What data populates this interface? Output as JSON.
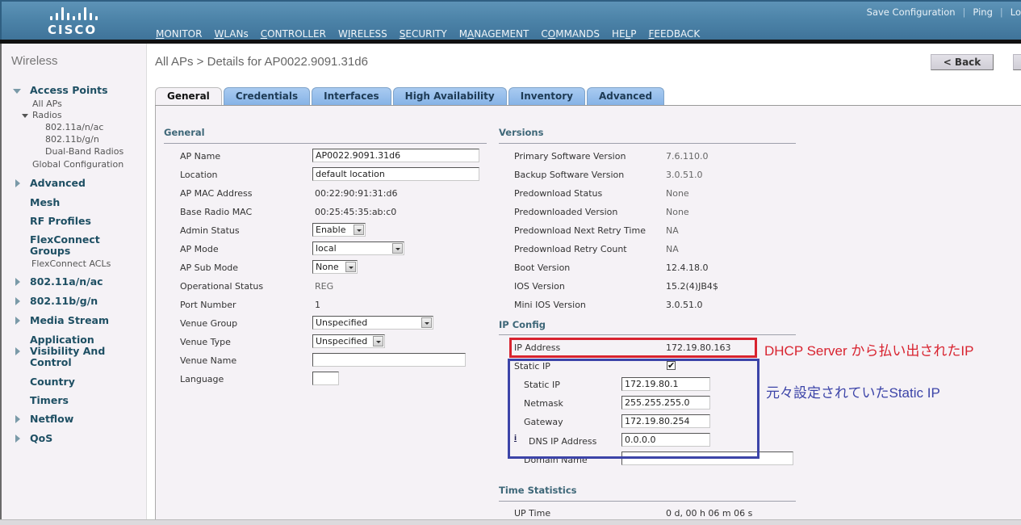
{
  "header": {
    "brand": "CISCO",
    "logo_icon": "cisco-bridge-logo",
    "top_links": [
      "Save Configuration",
      "Ping",
      "Lo"
    ],
    "nav": [
      {
        "label": "MONITOR",
        "active": false
      },
      {
        "label": "WLANs",
        "active": false
      },
      {
        "label": "CONTROLLER",
        "active": false
      },
      {
        "label": "WIRELESS",
        "active": true
      },
      {
        "label": "SECURITY",
        "active": false
      },
      {
        "label": "MANAGEMENT",
        "active": false
      },
      {
        "label": "COMMANDS",
        "active": false
      },
      {
        "label": "HELP",
        "active": false
      },
      {
        "label": "FEEDBACK",
        "active": false
      }
    ],
    "accent_color": "#e0942e"
  },
  "sidebar": {
    "title": "Wireless",
    "access_points": {
      "label": "Access Points",
      "all_aps": "All APs",
      "radios": "Radios",
      "radio_items": [
        "802.11a/n/ac",
        "802.11b/g/n",
        "Dual-Band Radios"
      ],
      "global_config": "Global Configuration"
    },
    "items": [
      {
        "label": "Advanced"
      },
      {
        "label": "Mesh"
      },
      {
        "label": "RF Profiles"
      },
      {
        "label": "FlexConnect Groups"
      },
      {
        "label": "FlexConnect ACLs"
      },
      {
        "label": "802.11a/n/ac"
      },
      {
        "label": "802.11b/g/n"
      },
      {
        "label": "Media Stream"
      },
      {
        "label": "Application Visibility And Control"
      },
      {
        "label": "Country"
      },
      {
        "label": "Timers"
      },
      {
        "label": "Netflow"
      },
      {
        "label": "QoS"
      }
    ]
  },
  "page": {
    "title": "All APs > Details for AP0022.9091.31d6",
    "back_label": "< Back",
    "tabs": [
      "General",
      "Credentials",
      "Interfaces",
      "High Availability",
      "Inventory",
      "Advanced"
    ],
    "active_tab": "General"
  },
  "general": {
    "title": "General",
    "ap_name_label": "AP Name",
    "ap_name": "AP0022.9091.31d6",
    "location_label": "Location",
    "location": "default location",
    "ap_mac_label": "AP MAC Address",
    "ap_mac": "00:22:90:91:31:d6",
    "base_radio_mac_label": "Base Radio MAC",
    "base_radio_mac": "00:25:45:35:ab:c0",
    "admin_status_label": "Admin Status",
    "admin_status": "Enable",
    "ap_mode_label": "AP Mode",
    "ap_mode": "local",
    "ap_sub_mode_label": "AP Sub Mode",
    "ap_sub_mode": "None",
    "oper_status_label": "Operational Status",
    "oper_status": "REG",
    "port_number_label": "Port Number",
    "port_number": "1",
    "venue_group_label": "Venue Group",
    "venue_group": "Unspecified",
    "venue_type_label": "Venue Type",
    "venue_type": "Unspecified",
    "venue_name_label": "Venue Name",
    "venue_name": "",
    "language_label": "Language",
    "language": ""
  },
  "versions": {
    "title": "Versions",
    "rows": [
      {
        "label": "Primary Software Version",
        "value": "7.6.110.0"
      },
      {
        "label": "Backup Software Version",
        "value": "3.0.51.0"
      },
      {
        "label": "Predownload Status",
        "value": "None"
      },
      {
        "label": "Predownloaded Version",
        "value": "None"
      },
      {
        "label": "Predownload Next Retry Time",
        "value": "NA"
      },
      {
        "label": "Predownload Retry Count",
        "value": "NA"
      },
      {
        "label": "Boot Version",
        "value": "12.4.18.0"
      },
      {
        "label": "IOS Version",
        "value": "15.2(4)JB4$"
      },
      {
        "label": "Mini IOS Version",
        "value": "3.0.51.0"
      }
    ]
  },
  "ip_config": {
    "title": "IP Config",
    "ip_address_label": "IP Address",
    "ip_address": "172.19.80.163",
    "static_ip_checkbox_label": "Static IP",
    "static_ip_checked": true,
    "checkmark": "✔",
    "static_ip_label": "Static IP",
    "static_ip": "172.19.80.1",
    "netmask_label": "Netmask",
    "netmask": "255.255.255.0",
    "gateway_label": "Gateway",
    "gateway": "172.19.80.254",
    "dns_label": "DNS IP Address",
    "dns": "0.0.0.0",
    "dns_info_icon": "i",
    "domain_label": "Domain Name",
    "domain": ""
  },
  "time_stats": {
    "title": "Time Statistics",
    "uptime_label": "UP Time",
    "uptime": "0 d, 00 h 06 m 06 s"
  },
  "annotations": {
    "dhcp_note": "DHCP Server から払い出されたIP",
    "dhcp_color": "#d8232f",
    "static_note": "元々設定されていたStatic IP",
    "static_color": "#3c44a8"
  }
}
